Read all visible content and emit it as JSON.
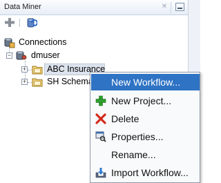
{
  "panel": {
    "title": "Data Miner",
    "close_glyph": "✕",
    "toolbar": {
      "add_icon": "plus-icon",
      "refresh_icon": "refresh-connections-icon"
    }
  },
  "tree": {
    "root": {
      "label": "Connections",
      "icon": "connections-icon"
    },
    "connection": {
      "label": "dmuser",
      "icon": "database-user-icon",
      "expander": "−"
    },
    "projects": [
      {
        "label": "ABC Insurance",
        "icon": "folder-icon",
        "expander": "+",
        "selected": true
      },
      {
        "label": "SH Schema",
        "icon": "folder-icon",
        "expander": "+"
      }
    ]
  },
  "context_menu": {
    "items": [
      {
        "label": "New Workflow...",
        "icon": "",
        "highlighted": true
      },
      {
        "label": "New Project...",
        "icon": "green-plus-icon"
      },
      {
        "label": "Delete",
        "icon": "red-x-icon"
      },
      {
        "label": "Properties...",
        "icon": "properties-icon"
      },
      {
        "label": "Rename...",
        "icon": ""
      },
      {
        "label": "Import Workflow...",
        "icon": "import-icon"
      }
    ]
  },
  "colors": {
    "menu_highlight": "#2f73c4",
    "selection": "#dde4ee"
  }
}
